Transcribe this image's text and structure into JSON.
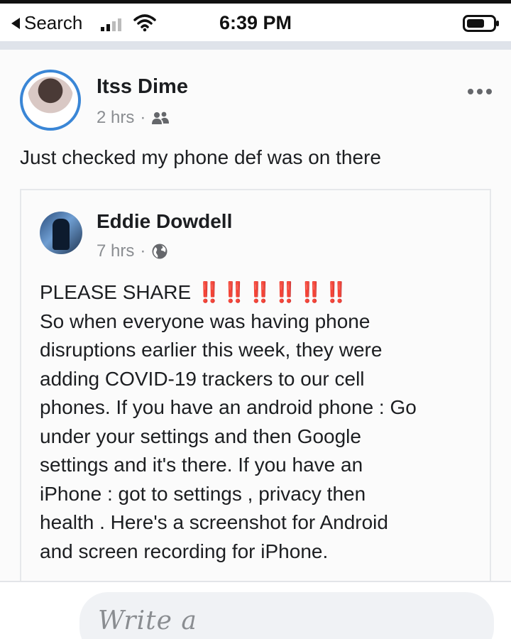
{
  "status_bar": {
    "back_label": "Search",
    "time": "6:39 PM",
    "icons": [
      "back-arrow-icon",
      "signal-icon",
      "wifi-icon",
      "battery-icon"
    ]
  },
  "post": {
    "author": "Itss Dime",
    "time_ago": "2 hrs",
    "separator": "·",
    "audience_icon": "friends-icon",
    "text": "Just checked my phone def was on there",
    "more_icon": "more-options-icon"
  },
  "shared_post": {
    "author": "Eddie Dowdell",
    "time_ago": "7 hrs",
    "separator": "·",
    "audience_icon": "globe-icon",
    "headline": "PLEASE SHARE",
    "bangs": "‼️‼️‼️‼️‼️‼️",
    "body_lines": [
      "So when everyone was having phone",
      "disruptions earlier this week, they were",
      "adding COVID-19 trackers to our cell",
      "phones. If you have an android phone : Go",
      "under your settings and then Google",
      "settings and it's there. If you have an",
      "iPhone : got to settings , privacy then",
      "health . Here's a screenshot for Android",
      "and screen recording for iPhone."
    ]
  },
  "comment_box": {
    "placeholder": "Write a"
  },
  "colors": {
    "avatar_ring": "#3a86d6",
    "bangs": "#e0202a",
    "meta_text": "#8a8d91",
    "separator_band": "#dfe3ea"
  }
}
